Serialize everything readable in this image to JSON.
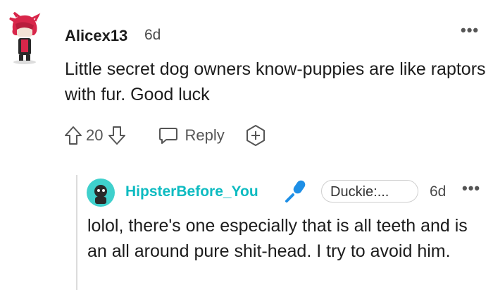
{
  "comment": {
    "username": "Alicex13",
    "age": "6d",
    "more": "•••",
    "body": "Little secret dog owners know-puppies are like raptors with fur. Good luck",
    "score": "20",
    "reply_label": "Reply"
  },
  "reply_comment": {
    "username": "HipsterBefore_You",
    "flair": "Duckie:...",
    "age": "6d",
    "more": "•••",
    "body": "lolol, there's one especially that is all teeth and is an all around pure shit-head. I try to avoid him."
  },
  "colors": {
    "text": "#1c1c1c",
    "muted": "#555555",
    "accent_teal": "#0dbbc1",
    "mic_blue": "#1e8fe6"
  },
  "icons": [
    "upvote-icon",
    "downvote-icon",
    "reply-icon",
    "award-icon",
    "microphone-icon",
    "more-icon"
  ]
}
